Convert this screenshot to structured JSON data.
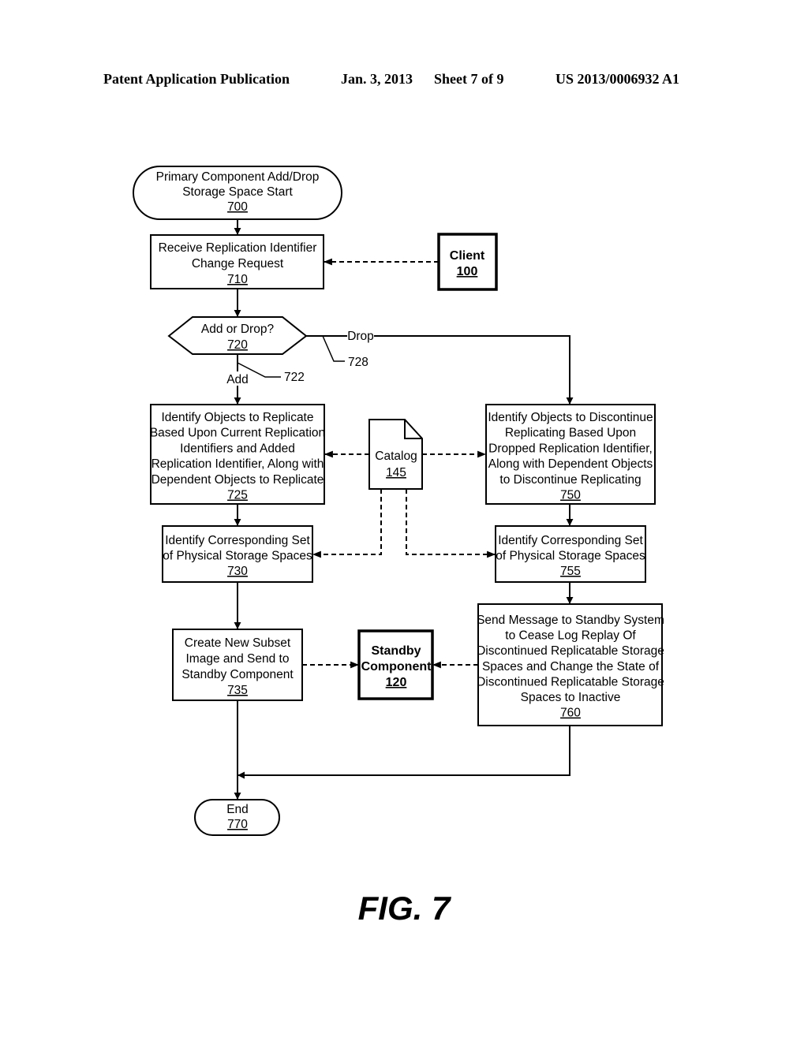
{
  "header": {
    "publication": "Patent Application Publication",
    "date": "Jan. 3, 2013",
    "sheet": "Sheet 7 of 9",
    "number": "US 2013/0006932 A1"
  },
  "nodes": {
    "n700": {
      "lines": [
        "Primary Component Add/Drop",
        "Storage Space Start"
      ],
      "ref": "700",
      "shape": "terminator"
    },
    "n710": {
      "lines": [
        "Receive Replication Identifier",
        "Change Request"
      ],
      "ref": "710",
      "shape": "process"
    },
    "client": {
      "lines": [
        "Client"
      ],
      "ref": "100",
      "shape": "external"
    },
    "n720": {
      "lines": [
        "Add or Drop?"
      ],
      "ref": "720",
      "shape": "decision"
    },
    "n725": {
      "lines": [
        "Identify Objects to Replicate",
        "Based Upon Current Replication",
        "Identifiers and Added",
        "Replication Identifier, Along with",
        "Dependent Objects to Replicate"
      ],
      "ref": "725",
      "shape": "process"
    },
    "catalog": {
      "lines": [
        "Catalog"
      ],
      "ref": "145",
      "shape": "document"
    },
    "n750": {
      "lines": [
        "Identify Objects to Discontinue",
        "Replicating Based Upon",
        "Dropped Replication Identifier,",
        "Along with Dependent Objects",
        "to Discontinue Replicating"
      ],
      "ref": "750",
      "shape": "process"
    },
    "n730": {
      "lines": [
        "Identify Corresponding Set",
        "of Physical Storage Spaces"
      ],
      "ref": "730",
      "shape": "process"
    },
    "n755": {
      "lines": [
        "Identify Corresponding Set",
        "of Physical Storage Spaces"
      ],
      "ref": "755",
      "shape": "process"
    },
    "n735": {
      "lines": [
        "Create New Subset",
        "Image and Send to",
        "Standby Component"
      ],
      "ref": "735",
      "shape": "process"
    },
    "standby": {
      "lines": [
        "Standby",
        "Component"
      ],
      "ref": "120",
      "shape": "external"
    },
    "n760": {
      "lines": [
        "Send Message to Standby System",
        "to Cease Log Replay Of",
        "Discontinued Replicatable Storage",
        "Spaces and Change the State of",
        "Discontinued Replicatable Storage",
        "Spaces to Inactive"
      ],
      "ref": "760",
      "shape": "process"
    },
    "n770": {
      "lines": [
        "End"
      ],
      "ref": "770",
      "shape": "terminator"
    }
  },
  "edge_labels": {
    "add": "Add",
    "add_ref": "722",
    "drop": "Drop",
    "drop_ref": "728"
  },
  "figure_label": "FIG. 7"
}
